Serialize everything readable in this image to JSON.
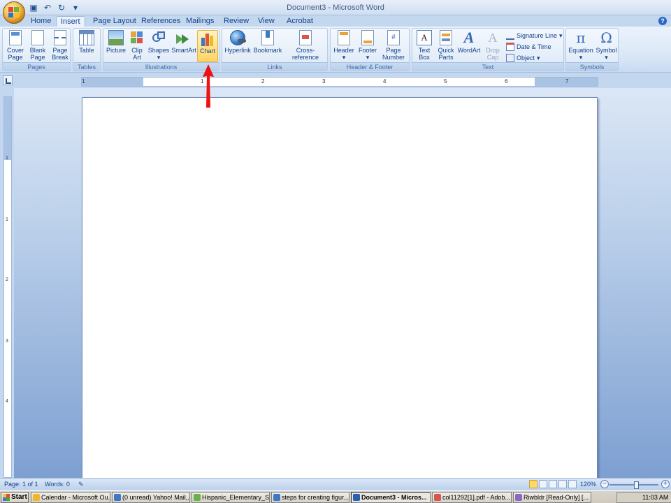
{
  "window": {
    "title": "Document3 - Microsoft Word"
  },
  "tabs": [
    "Home",
    "Insert",
    "Page Layout",
    "References",
    "Mailings",
    "Review",
    "View",
    "Acrobat"
  ],
  "active_tab": "Insert",
  "ribbon": {
    "pages": {
      "label": "Pages",
      "cover": [
        "Cover",
        "Page"
      ],
      "blank": [
        "Blank",
        "Page"
      ],
      "break": [
        "Page",
        "Break"
      ]
    },
    "tables": {
      "label": "Tables",
      "table": "Table"
    },
    "illustrations": {
      "label": "Illustrations",
      "picture": "Picture",
      "clipart": [
        "Clip",
        "Art"
      ],
      "shapes": "Shapes",
      "smartart": "SmartArt",
      "chart": "Chart"
    },
    "links": {
      "label": "Links",
      "hyperlink": "Hyperlink",
      "bookmark": "Bookmark",
      "crossref": "Cross-reference"
    },
    "header_footer": {
      "label": "Header & Footer",
      "header": "Header",
      "footer": "Footer",
      "pagenumber": [
        "Page",
        "Number"
      ]
    },
    "text": {
      "label": "Text",
      "textbox": [
        "Text",
        "Box"
      ],
      "quickparts": [
        "Quick",
        "Parts"
      ],
      "wordart": "WordArt",
      "dropcap": [
        "Drop",
        "Cap"
      ],
      "signature": "Signature Line",
      "datetime": "Date & Time",
      "object": "Object"
    },
    "symbols": {
      "label": "Symbols",
      "equation": "Equation",
      "symbol": "Symbol"
    }
  },
  "ruler": {
    "numbers": [
      "1",
      "1",
      "2",
      "3",
      "4",
      "5",
      "6",
      "7"
    ]
  },
  "vruler": {
    "numbers": [
      "1",
      "1",
      "2",
      "3",
      "4"
    ]
  },
  "status": {
    "page": "Page: 1 of 1",
    "words": "Words: 0",
    "zoom": "120%"
  },
  "taskbar": {
    "start": "Start",
    "items": [
      "Calendar - Microsoft Ou...",
      "(0 unread) Yahoo! Mail,...",
      "Hispanic_Elementary_S...",
      "steps for creating figur...",
      "Document3 - Micros...",
      "col11292[1].pdf - Adob...",
      "Riwbldr  [Read-Only]  [..."
    ],
    "clock": "11:03 AM"
  },
  "colors": {
    "accent": "#15428b",
    "highlight": "#ffd35f",
    "arrow": "#ee1111"
  }
}
